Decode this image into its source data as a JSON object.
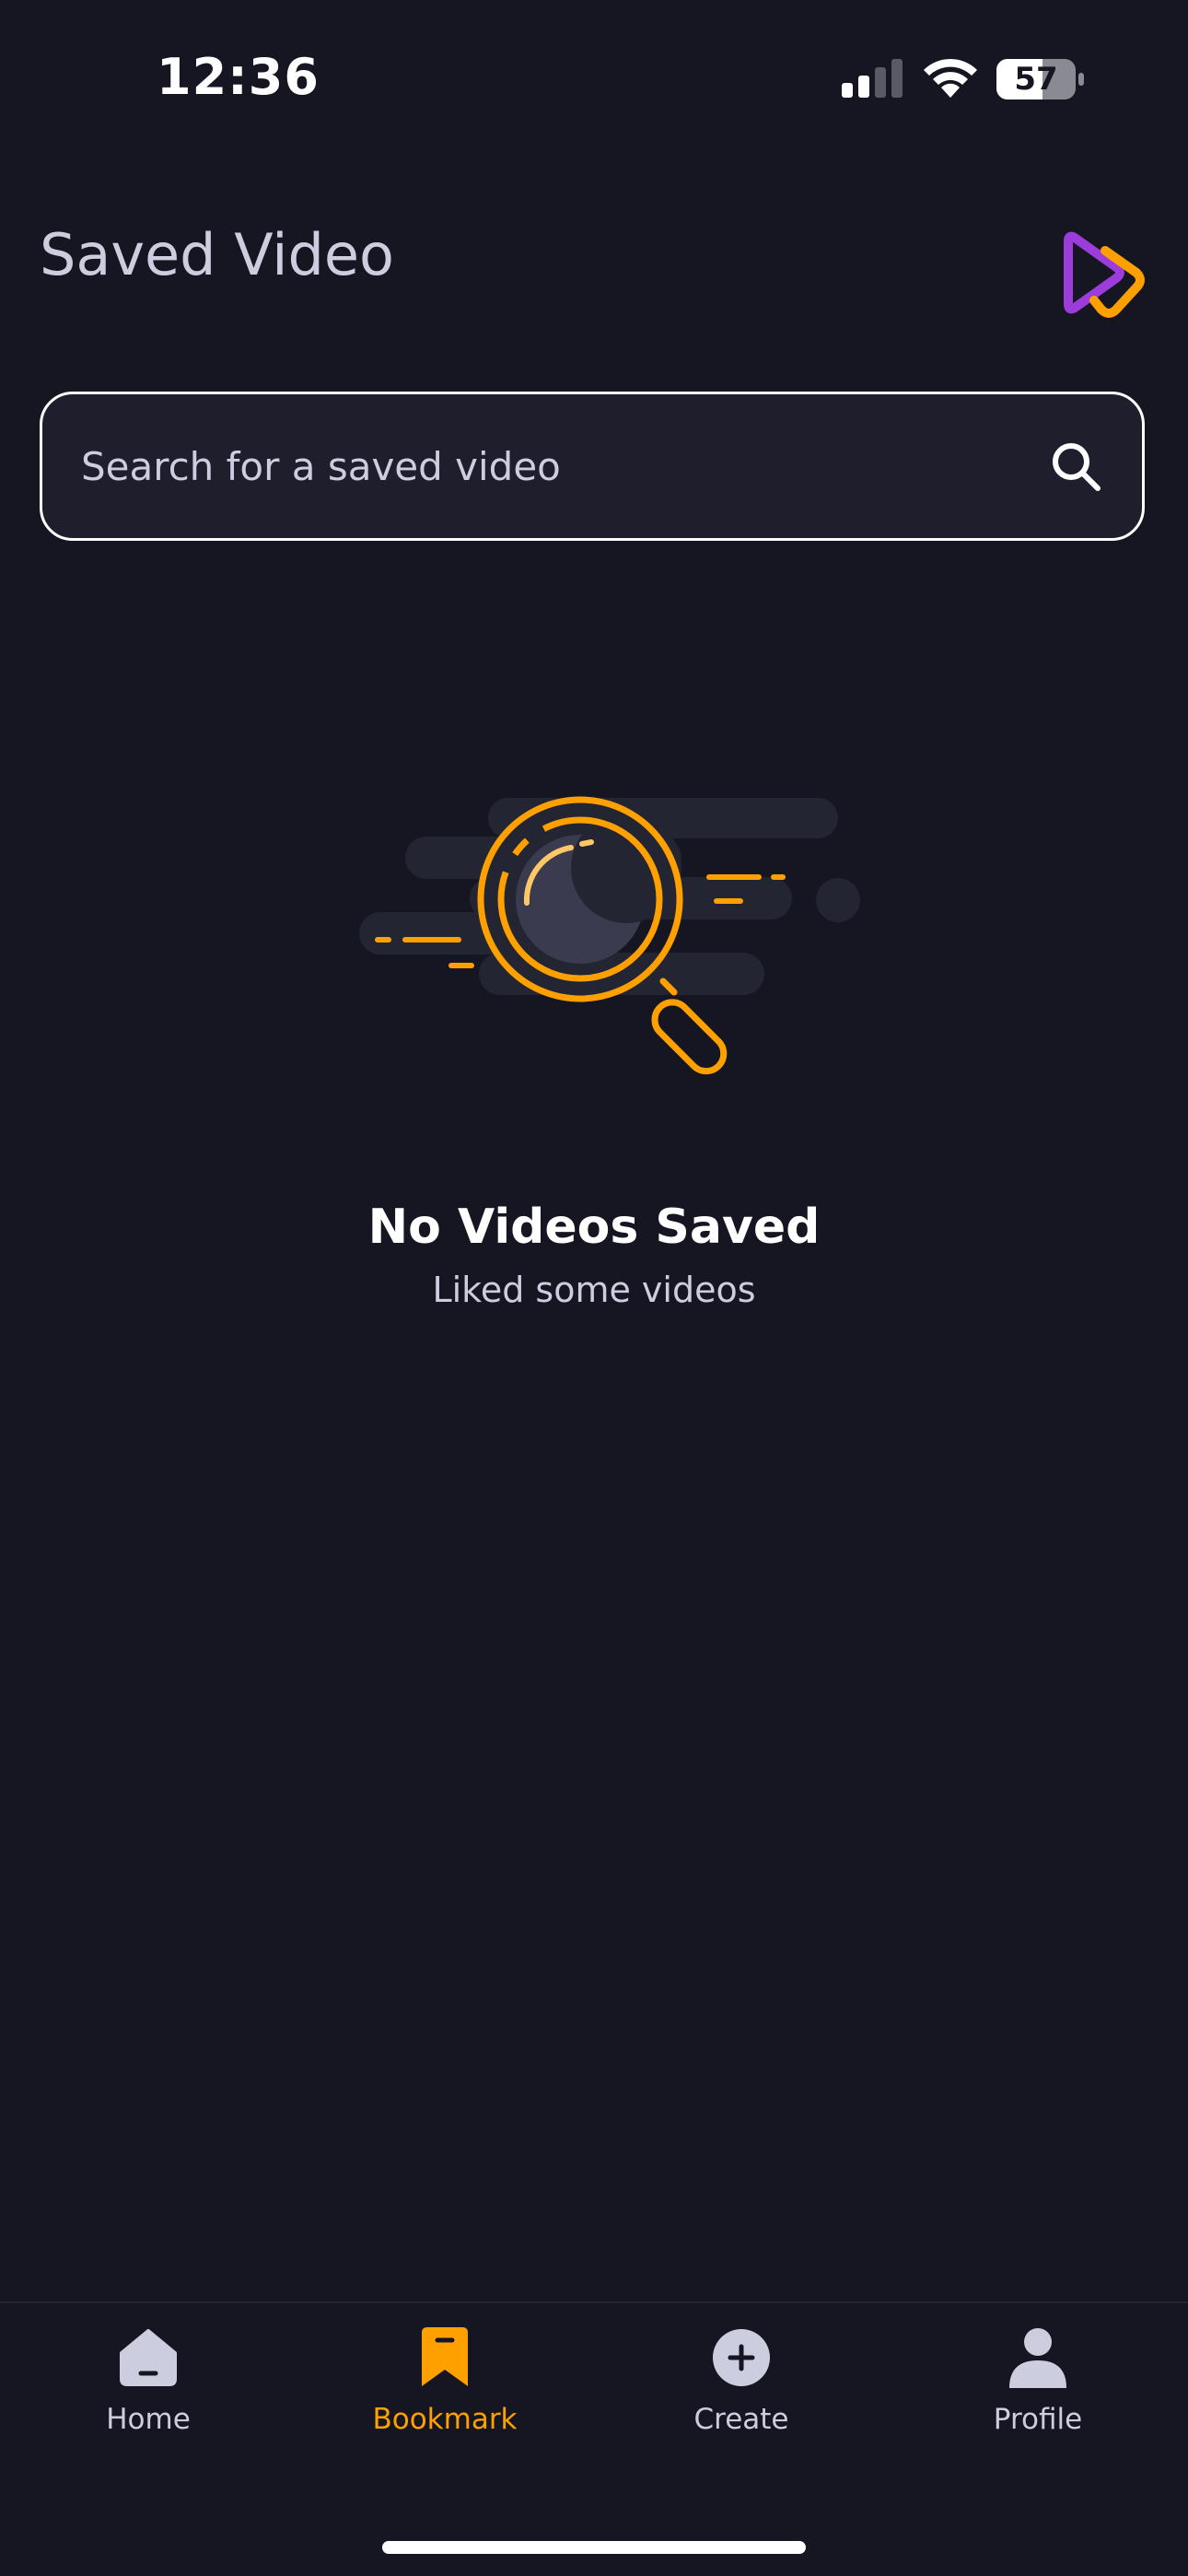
{
  "status_bar": {
    "time": "12:36",
    "battery": "57",
    "icons": [
      "signal-icon",
      "wifi-icon",
      "battery-icon"
    ]
  },
  "header": {
    "title": "Saved Video",
    "logo_icon": "play-logo-icon"
  },
  "search": {
    "placeholder": "Search for a saved video",
    "value": "",
    "icon": "search-icon"
  },
  "empty_state": {
    "illustration_icon": "magnifier-illustration-icon",
    "title": "No Videos Saved",
    "subtitle": "Liked some videos"
  },
  "tabs": [
    {
      "label": "Home",
      "icon": "home-icon",
      "active": false
    },
    {
      "label": "Bookmark",
      "icon": "bookmark-icon",
      "active": true
    },
    {
      "label": "Create",
      "icon": "plus-circle-icon",
      "active": false
    },
    {
      "label": "Profile",
      "icon": "profile-icon",
      "active": false
    }
  ],
  "colors": {
    "background": "#161622",
    "surface": "#1E1E2D",
    "accent": "#FFA001",
    "muted_text": "#CDCDE0",
    "logo_purple": "#9B3CDB"
  }
}
